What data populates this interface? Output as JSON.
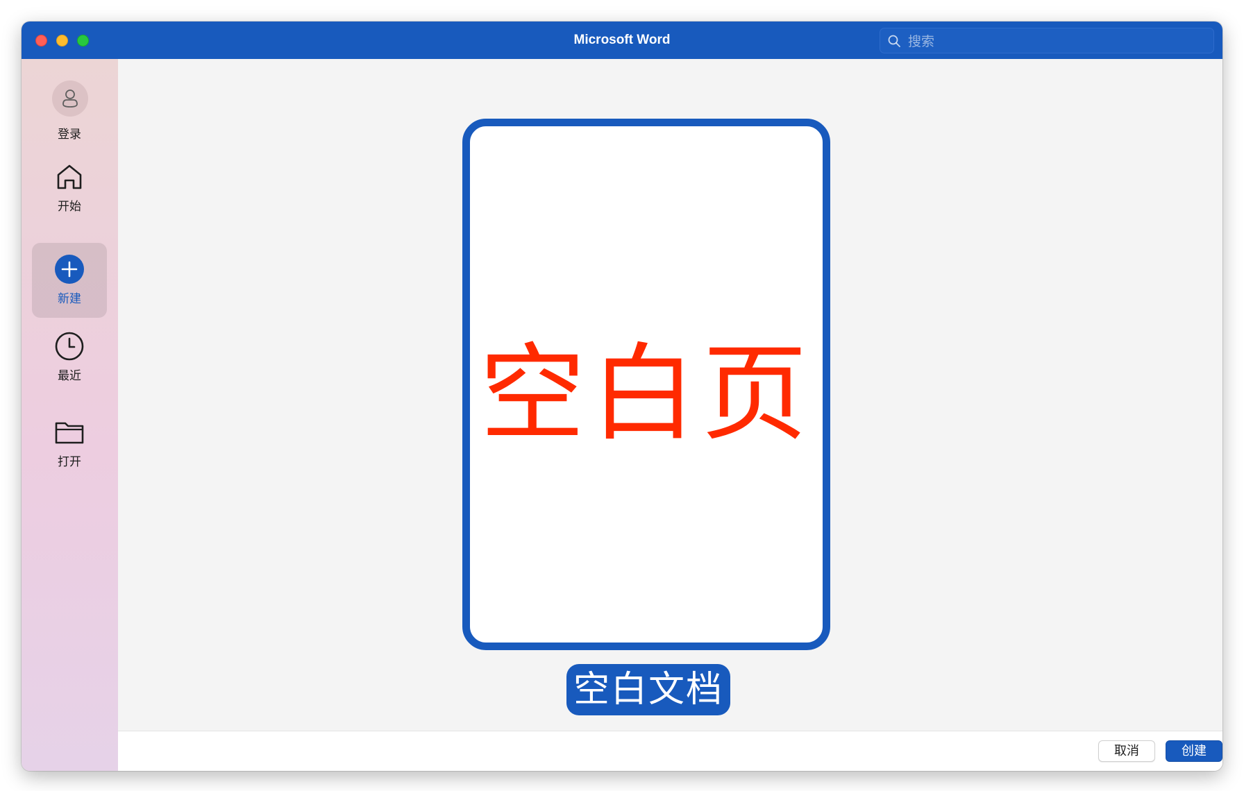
{
  "app": {
    "title": "Microsoft Word",
    "search_placeholder": "搜索"
  },
  "sidebar": {
    "items": [
      {
        "label": "登录",
        "icon": "avatar-icon",
        "selected": false
      },
      {
        "label": "开始",
        "icon": "home-icon",
        "selected": false
      },
      {
        "label": "新建",
        "icon": "plus-circle-icon",
        "selected": true
      },
      {
        "label": "最近",
        "icon": "clock-icon",
        "selected": false
      },
      {
        "label": "打开",
        "icon": "folder-icon",
        "selected": false
      }
    ]
  },
  "main": {
    "template": {
      "preview_text": "空白页",
      "label": "空白文档"
    }
  },
  "footer": {
    "cancel_label": "取消",
    "create_label": "创建"
  },
  "colors": {
    "brand": "#185abd",
    "preview_text": "#ff2a00"
  }
}
